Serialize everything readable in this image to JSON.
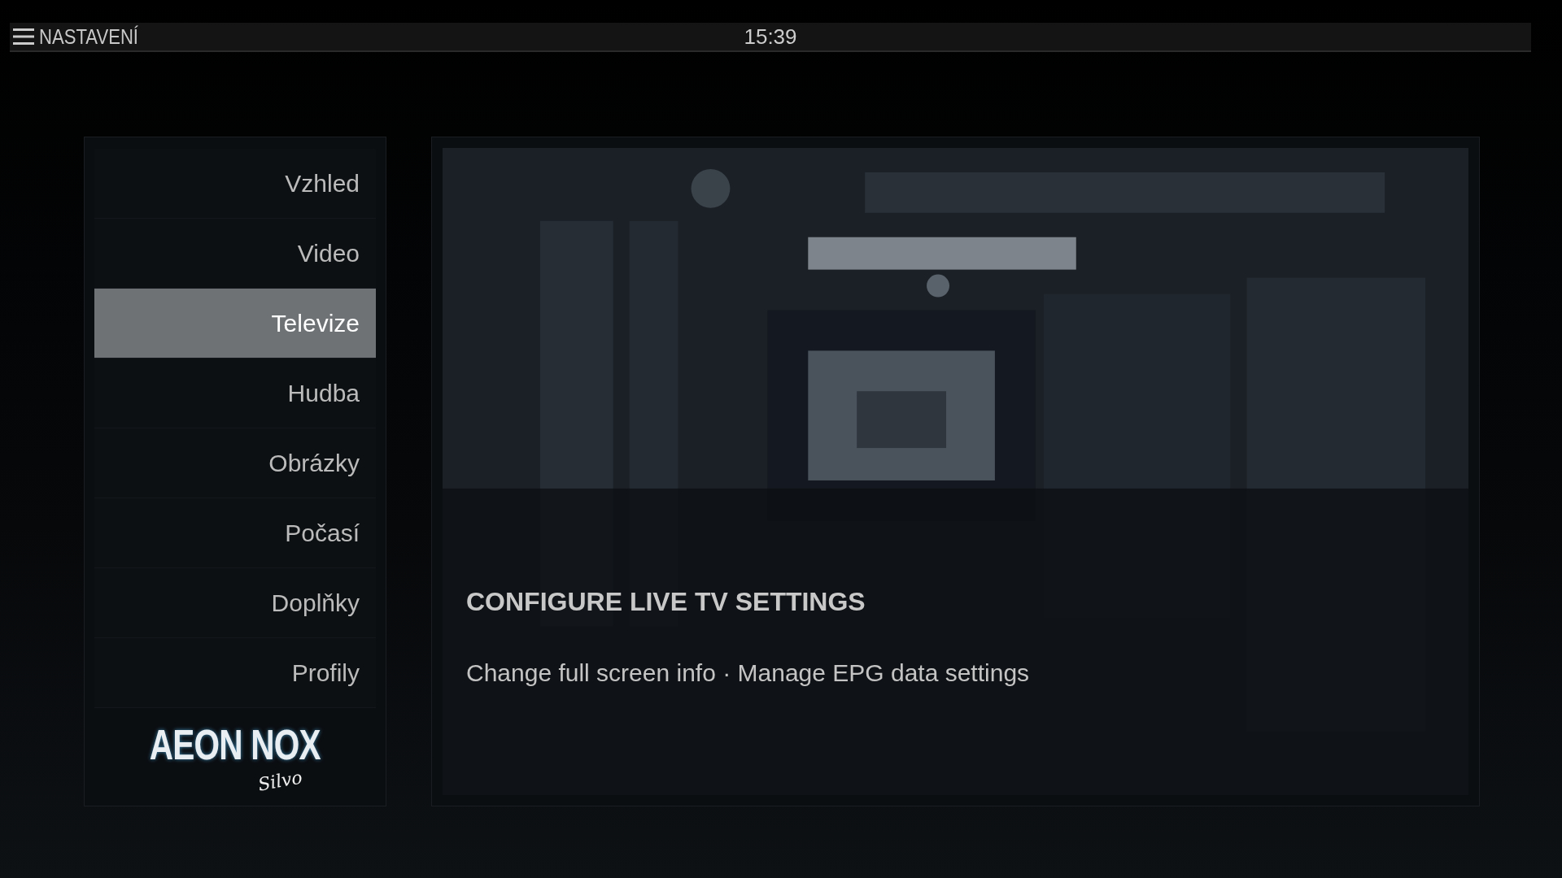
{
  "header": {
    "title": "NASTAVENÍ",
    "clock": "15:39"
  },
  "menu": [
    {
      "label": "Vzhled",
      "selected": false
    },
    {
      "label": "Video",
      "selected": false
    },
    {
      "label": "Televize",
      "selected": true
    },
    {
      "label": "Hudba",
      "selected": false
    },
    {
      "label": "Obrázky",
      "selected": false
    },
    {
      "label": "Počasí",
      "selected": false
    },
    {
      "label": "Doplňky",
      "selected": false
    },
    {
      "label": "Profily",
      "selected": false
    }
  ],
  "logo": {
    "title": "AEON NOX",
    "subtitle": "Silvo"
  },
  "detail": {
    "kind": "picture",
    "heading": "CONFIGURE LIVE TV SETTINGS",
    "description": "Change full screen info · Manage EPG data settings"
  }
}
